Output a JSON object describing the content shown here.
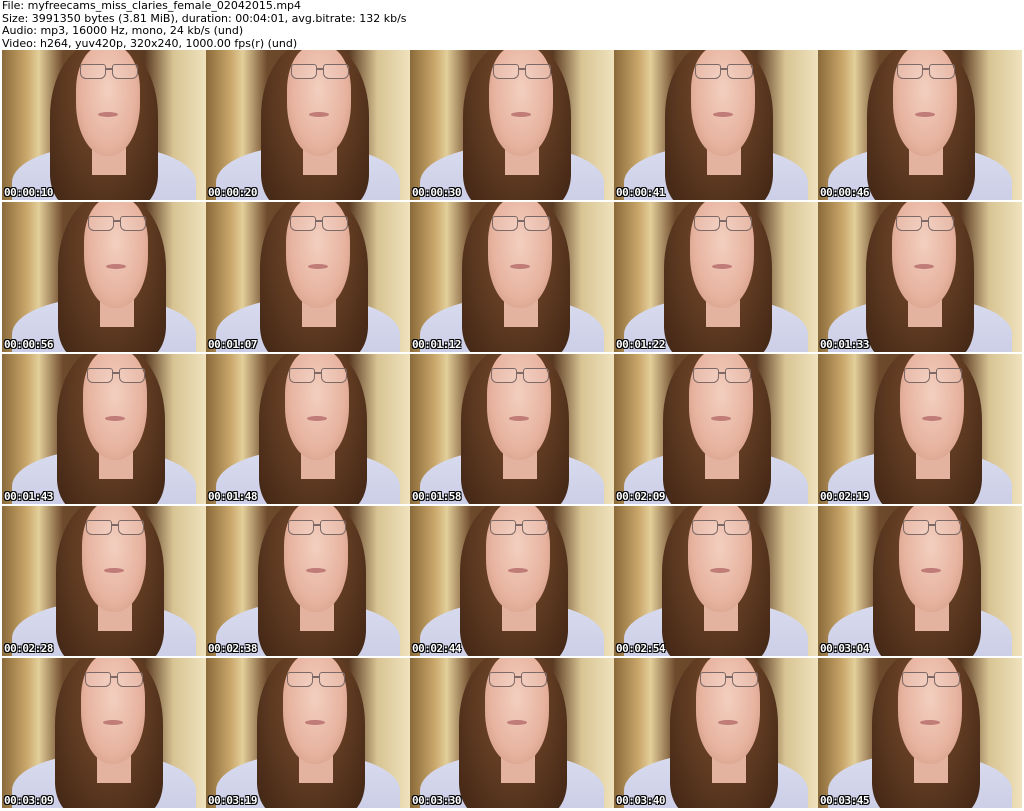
{
  "header": {
    "file_line": "File: myfreecams_miss_claries_female_02042015.mp4",
    "size_line": "Size: 3991350 bytes (3.81 MiB), duration: 00:04:01, avg.bitrate: 132 kb/s",
    "audio_line": "Audio: mp3, 16000 Hz, mono, 24 kb/s (und)",
    "video_line": "Video: h264, yuv420p, 320x240, 1000.00 fps(r) (und)"
  },
  "thumbnails": [
    {
      "timestamp": "00:00:10"
    },
    {
      "timestamp": "00:00:20"
    },
    {
      "timestamp": "00:00:30"
    },
    {
      "timestamp": "00:00:41"
    },
    {
      "timestamp": "00:00:46"
    },
    {
      "timestamp": "00:00:56"
    },
    {
      "timestamp": "00:01:07"
    },
    {
      "timestamp": "00:01:12"
    },
    {
      "timestamp": "00:01:22"
    },
    {
      "timestamp": "00:01:33"
    },
    {
      "timestamp": "00:01:43"
    },
    {
      "timestamp": "00:01:48"
    },
    {
      "timestamp": "00:01:58"
    },
    {
      "timestamp": "00:02:09"
    },
    {
      "timestamp": "00:02:19"
    },
    {
      "timestamp": "00:02:28"
    },
    {
      "timestamp": "00:02:38"
    },
    {
      "timestamp": "00:02:44"
    },
    {
      "timestamp": "00:02:54"
    },
    {
      "timestamp": "00:03:04"
    },
    {
      "timestamp": "00:03:09"
    },
    {
      "timestamp": "00:03:19"
    },
    {
      "timestamp": "00:03:30"
    },
    {
      "timestamp": "00:03:40"
    },
    {
      "timestamp": "00:03:45"
    }
  ]
}
